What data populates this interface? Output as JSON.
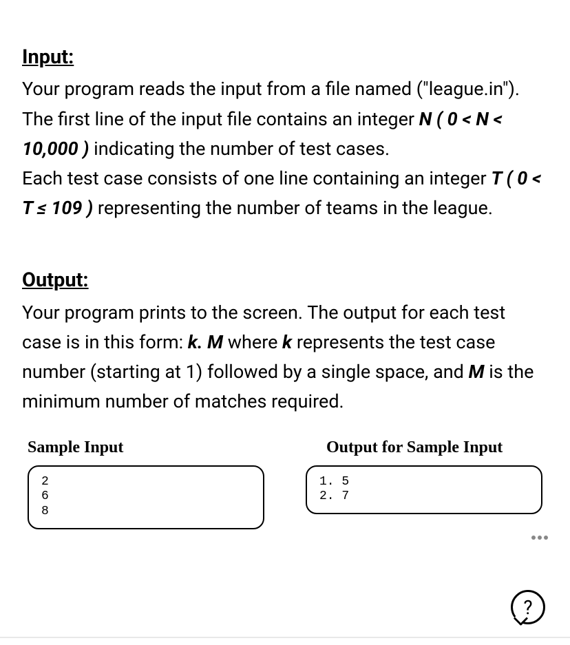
{
  "input": {
    "heading": "Input:",
    "line1": "Your program reads the input from a file named (\"league.in\").",
    "line2_part1": "The first line of the input file contains an integer ",
    "line2_bold": "N ( 0 < N < 10,000 )",
    "line2_part2": " indicating the number of test cases.",
    "line3_part1": "Each test case consists of one line containing an integer ",
    "line3_bold": "T ( 0 < T ≤ 109 )",
    "line3_part2": " representing the number of teams in the league."
  },
  "output": {
    "heading": "Output:",
    "line1_part1": "Your program prints to the screen. The output for each test case is in this form: ",
    "line1_bold1": "k. M",
    "line1_part2": " where ",
    "line1_bold2": "k",
    "line1_part3": " represents the test case number (starting at 1) followed by a single space, and ",
    "line1_bold3": "M",
    "line1_part4": " is the minimum number of matches required."
  },
  "sample": {
    "input_heading": "Sample Input",
    "output_heading": "Output for Sample Input",
    "input_text": "2\n6\n8",
    "output_text": "1. 5\n2. 7"
  },
  "help_label": "?"
}
